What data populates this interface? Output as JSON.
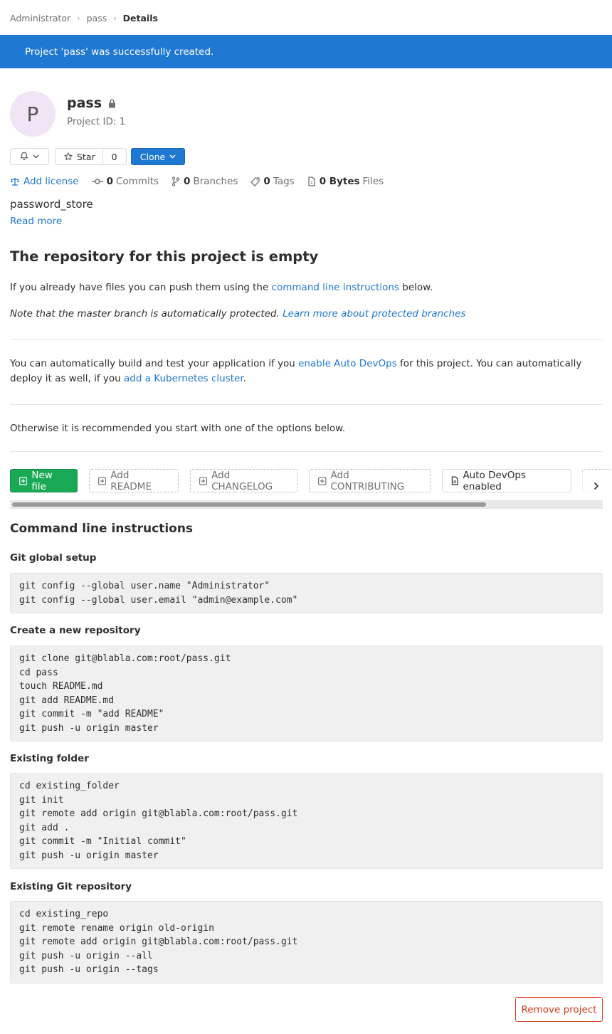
{
  "breadcrumb": {
    "items": [
      "Administrator",
      "pass"
    ],
    "current": "Details"
  },
  "flash": {
    "message": "Project 'pass' was successfully created.",
    "color": "#1f78d1"
  },
  "project": {
    "avatar_letter": "P",
    "name": "pass",
    "id_text": "Project ID: 1",
    "visibility_icon": "lock-icon"
  },
  "buttons": {
    "notification_icon": "bell-icon",
    "star_label": "Star",
    "star_count": "0",
    "clone_label": "Clone"
  },
  "stats": {
    "add_license": "Add license",
    "commits_count": "0",
    "commits_label": "Commits",
    "branches_count": "0",
    "branches_label": "Branches",
    "tags_count": "0",
    "tags_label": "Tags",
    "files_size": "0 Bytes",
    "files_label": "Files"
  },
  "description": "password_store",
  "read_more": "Read more",
  "empty": {
    "heading": "The repository for this project is empty",
    "p1_before": "If you already have files you can push them using the ",
    "p1_link": "command line instructions",
    "p1_after": " below.",
    "p2_text": "Note that the master branch is automatically protected. ",
    "p2_link": "Learn more about protected branches",
    "p3_a": "You can automatically build and test your application if you ",
    "p3_link1": "enable Auto DevOps",
    "p3_b": " for this project. You can automatically deploy it as well, if you ",
    "p3_link2": "add a Kubernetes cluster",
    "p3_c": ".",
    "p4": "Otherwise it is recommended you start with one of the options below."
  },
  "actions": {
    "new_file": "New file",
    "add_readme": "Add README",
    "add_changelog": "Add CHANGELOG",
    "add_contributing": "Add CONTRIBUTING",
    "auto_devops": "Auto DevOps enabled"
  },
  "cli": {
    "heading": "Command line instructions",
    "sections": [
      {
        "title": "Git global setup",
        "code": "git config --global user.name \"Administrator\"\ngit config --global user.email \"admin@example.com\""
      },
      {
        "title": "Create a new repository",
        "code": "git clone git@blabla.com:root/pass.git\ncd pass\ntouch README.md\ngit add README.md\ngit commit -m \"add README\"\ngit push -u origin master"
      },
      {
        "title": "Existing folder",
        "code": "cd existing_folder\ngit init\ngit remote add origin git@blabla.com:root/pass.git\ngit add .\ngit commit -m \"Initial commit\"\ngit push -u origin master"
      },
      {
        "title": "Existing Git repository",
        "code": "cd existing_repo\ngit remote rename origin old-origin\ngit remote add origin git@blabla.com:root/pass.git\ngit push -u origin --all\ngit push -u origin --tags"
      }
    ]
  },
  "remove_project": "Remove project",
  "colors": {
    "primary": "#1f78d1",
    "success": "#1aaa55",
    "danger": "#db3b21"
  }
}
